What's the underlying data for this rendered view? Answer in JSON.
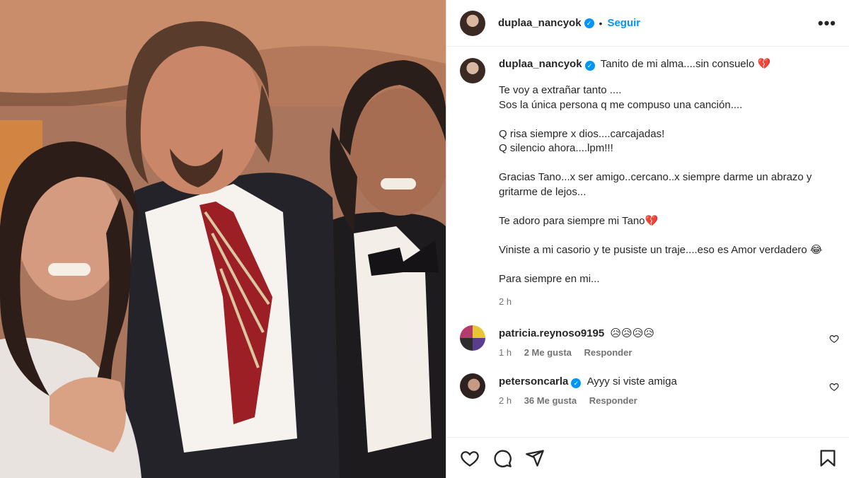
{
  "post": {
    "username": "duplaa_nancyok",
    "follow_label": "Seguir",
    "dot": "•",
    "more_label": "•••",
    "caption_first": "Tanito de mi alma....sin consuelo 💔",
    "caption_body": "Te voy a extrañar tanto ....\nSos la única persona q me compuso una canción....\n\nQ risa siempre x dios....carcajadas!\nQ silencio ahora....lpm!!!\n\nGracias Tano...x ser amigo..cercano..x siempre darme un abrazo y gritarme de lejos...\n\nTe adoro para siempre mi Tano💔\n\nViniste a mi casorio y te pusiste un traje....eso es Amor verdadero 😂\n\nPara siempre en mi...",
    "time": "2 h"
  },
  "comments": [
    {
      "username": "patricia.reynoso9195",
      "text": "😥😥😥😥",
      "verified": false,
      "time": "1 h",
      "likes": "2 Me gusta",
      "reply": "Responder"
    },
    {
      "username": "petersoncarla",
      "text": "Ayyy si viste amiga",
      "verified": true,
      "time": "2 h",
      "likes": "36 Me gusta",
      "reply": "Responder"
    }
  ],
  "icons": {
    "like": "heart-icon",
    "comment": "comment-icon",
    "share": "share-icon",
    "save": "bookmark-icon",
    "verified": "verified-badge-icon"
  },
  "colors": {
    "accent": "#0095f6",
    "muted": "#737373",
    "text": "#262626"
  }
}
